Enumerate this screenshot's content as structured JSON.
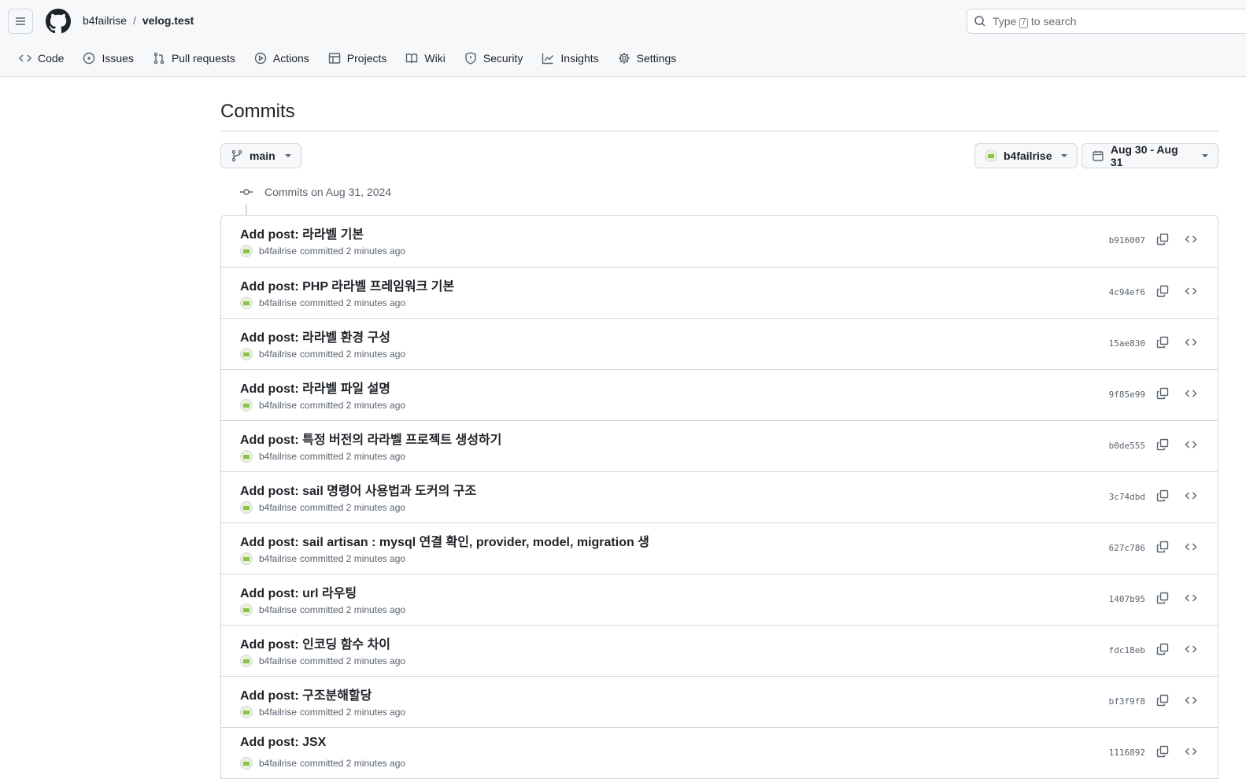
{
  "header": {
    "owner": "b4failrise",
    "separator": "/",
    "repo": "velog.test",
    "search_prefix": "Type",
    "search_key": "/",
    "search_suffix": "to search"
  },
  "nav": [
    {
      "label": "Code",
      "icon": "code-icon"
    },
    {
      "label": "Issues",
      "icon": "issue-icon"
    },
    {
      "label": "Pull requests",
      "icon": "pull-request-icon"
    },
    {
      "label": "Actions",
      "icon": "play-icon"
    },
    {
      "label": "Projects",
      "icon": "table-icon"
    },
    {
      "label": "Wiki",
      "icon": "book-icon"
    },
    {
      "label": "Security",
      "icon": "shield-icon"
    },
    {
      "label": "Insights",
      "icon": "graph-icon"
    },
    {
      "label": "Settings",
      "icon": "gear-icon"
    }
  ],
  "page": {
    "title": "Commits",
    "branch": "main",
    "author": "b4failrise",
    "date_range": "Aug 30 - Aug 31",
    "group_label": "Commits on Aug 31, 2024"
  },
  "commits": [
    {
      "title": "Add post: 라라벨 기본",
      "author": "b4failrise",
      "meta": "committed 2 minutes ago",
      "sha": "b916007"
    },
    {
      "title": "Add post: PHP 라라벨 프레임워크 기본",
      "author": "b4failrise",
      "meta": "committed 2 minutes ago",
      "sha": "4c94ef6"
    },
    {
      "title": "Add post: 라라벨 환경 구성",
      "author": "b4failrise",
      "meta": "committed 2 minutes ago",
      "sha": "15ae830"
    },
    {
      "title": "Add post: 라라벨 파일 설명",
      "author": "b4failrise",
      "meta": "committed 2 minutes ago",
      "sha": "9f85e99"
    },
    {
      "title": "Add post: 특정 버전의 라라벨 프로젝트 생성하기",
      "author": "b4failrise",
      "meta": "committed 2 minutes ago",
      "sha": "b0de555"
    },
    {
      "title": "Add post: sail 명령어 사용법과 도커의 구조",
      "author": "b4failrise",
      "meta": "committed 2 minutes ago",
      "sha": "3c74dbd"
    },
    {
      "title": "Add post: sail artisan : mysql 연결 확인, provider, model, migration 생",
      "author": "b4failrise",
      "meta": "committed 2 minutes ago",
      "sha": "627c786"
    },
    {
      "title": "Add post: url 라우팅",
      "author": "b4failrise",
      "meta": "committed 2 minutes ago",
      "sha": "1407b95"
    },
    {
      "title": "Add post: 인코딩 함수 차이",
      "author": "b4failrise",
      "meta": "committed 2 minutes ago",
      "sha": "fdc18eb"
    },
    {
      "title": "Add post: 구조분해할당",
      "author": "b4failrise",
      "meta": "committed 2 minutes ago",
      "sha": "bf3f9f8"
    },
    {
      "title": "Add post: JSX",
      "author": "b4failrise",
      "meta": "committed 2 minutes ago",
      "sha": "1116892"
    }
  ]
}
